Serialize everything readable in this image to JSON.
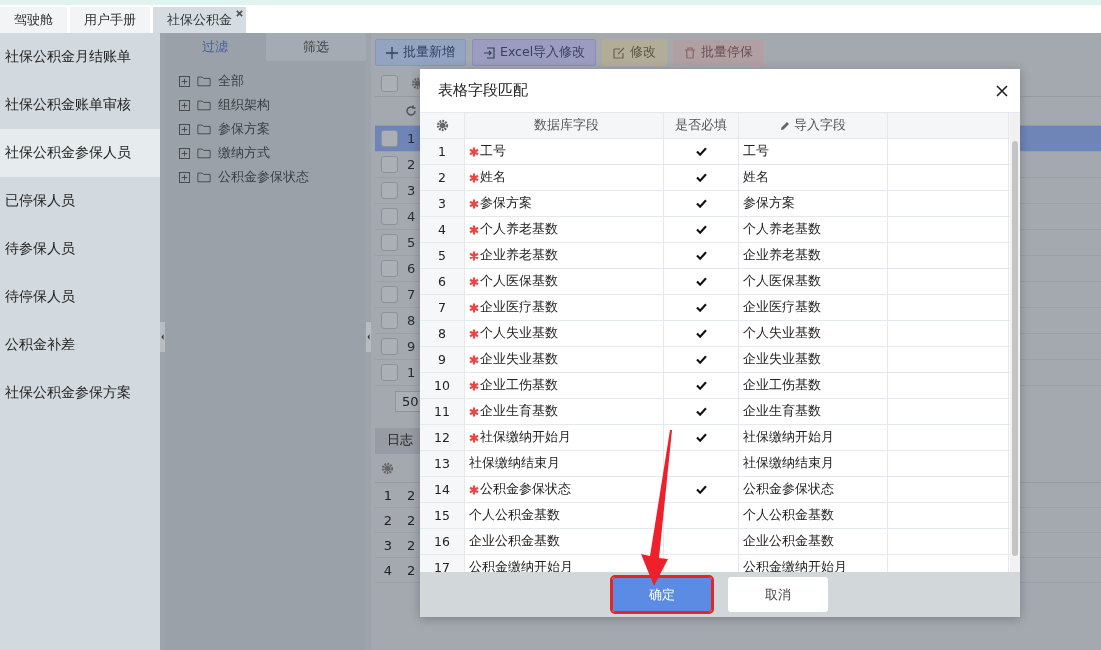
{
  "tabs": [
    {
      "label": "驾驶舱",
      "selected": false,
      "closable": false
    },
    {
      "label": "用户手册",
      "selected": false,
      "closable": false
    },
    {
      "label": "社保公积金",
      "selected": true,
      "closable": true
    }
  ],
  "sidebar": {
    "items": [
      {
        "label": "社保公积金月结账单",
        "selected": false
      },
      {
        "label": "社保公积金账单审核",
        "selected": false
      },
      {
        "label": "社保公积金参保人员",
        "selected": true
      },
      {
        "label": "已停保人员",
        "selected": false
      },
      {
        "label": "待参保人员",
        "selected": false
      },
      {
        "label": "待停保人员",
        "selected": false
      },
      {
        "label": "公积金补差",
        "selected": false
      },
      {
        "label": "社保公积金参保方案",
        "selected": false
      }
    ]
  },
  "filter_panel": {
    "tabs": [
      {
        "label": "过滤",
        "selected": true
      },
      {
        "label": "筛选",
        "selected": false
      }
    ],
    "tree": [
      {
        "label": "全部"
      },
      {
        "label": "组织架构"
      },
      {
        "label": "参保方案"
      },
      {
        "label": "缴纳方式"
      },
      {
        "label": "公积金参保状态"
      }
    ]
  },
  "toolbar": [
    {
      "kind": "add",
      "label": "批量新增"
    },
    {
      "kind": "import",
      "label": "Excel导入修改"
    },
    {
      "kind": "edit",
      "label": "修改"
    },
    {
      "kind": "delete",
      "label": "批量停保"
    }
  ],
  "table": {
    "all_checked": false,
    "rows": [
      {
        "num": "1",
        "selected": true,
        "checked": false
      },
      {
        "num": "2",
        "selected": false,
        "checked": false
      },
      {
        "num": "3",
        "selected": false,
        "checked": false
      },
      {
        "num": "4",
        "selected": false,
        "checked": false
      },
      {
        "num": "5",
        "selected": false,
        "checked": false
      },
      {
        "num": "6",
        "selected": false,
        "checked": false
      },
      {
        "num": "7",
        "selected": false,
        "checked": false
      },
      {
        "num": "8",
        "selected": false,
        "checked": false
      },
      {
        "num": "9",
        "selected": false,
        "checked": false
      },
      {
        "num": "1",
        "selected": false,
        "checked": false
      }
    ],
    "page_size": "50"
  },
  "log_panel": {
    "tab": "日志",
    "rows": [
      {
        "num": "1",
        "column_2": "2"
      },
      {
        "num": "2",
        "column_2": "2"
      },
      {
        "num": "3",
        "column_2": "2"
      },
      {
        "num": "4",
        "column_2": "2"
      }
    ]
  },
  "dialog": {
    "title": "表格字段匹配",
    "columns": [
      "数据库字段",
      "是否必填",
      "导入字段"
    ],
    "rows": [
      {
        "num": "1",
        "field": "工号",
        "required": true,
        "import": "工号"
      },
      {
        "num": "2",
        "field": "姓名",
        "required": true,
        "import": "姓名"
      },
      {
        "num": "3",
        "field": "参保方案",
        "required": true,
        "import": "参保方案"
      },
      {
        "num": "4",
        "field": "个人养老基数",
        "required": true,
        "import": "个人养老基数"
      },
      {
        "num": "5",
        "field": "企业养老基数",
        "required": true,
        "import": "企业养老基数"
      },
      {
        "num": "6",
        "field": "个人医保基数",
        "required": true,
        "import": "个人医保基数"
      },
      {
        "num": "7",
        "field": "企业医疗基数",
        "required": true,
        "import": "企业医疗基数"
      },
      {
        "num": "8",
        "field": "个人失业基数",
        "required": true,
        "import": "个人失业基数"
      },
      {
        "num": "9",
        "field": "企业失业基数",
        "required": true,
        "import": "企业失业基数"
      },
      {
        "num": "10",
        "field": "企业工伤基数",
        "required": true,
        "import": "企业工伤基数"
      },
      {
        "num": "11",
        "field": "企业生育基数",
        "required": true,
        "import": "企业生育基数"
      },
      {
        "num": "12",
        "field": "社保缴纳开始月",
        "required": true,
        "import": "社保缴纳开始月"
      },
      {
        "num": "13",
        "field": "社保缴纳结束月",
        "required": false,
        "import": "社保缴纳结束月"
      },
      {
        "num": "14",
        "field": "公积金参保状态",
        "required": true,
        "import": "公积金参保状态"
      },
      {
        "num": "15",
        "field": "个人公积金基数",
        "required": false,
        "import": "个人公积金基数"
      },
      {
        "num": "16",
        "field": "企业公积金基数",
        "required": false,
        "import": "企业公积金基数"
      },
      {
        "num": "17",
        "field": "公积金缴纳开始月",
        "required": false,
        "import": "公积金缴纳开始月"
      }
    ],
    "buttons": [
      {
        "kind": "primary",
        "label": "确定",
        "highlighted": true
      },
      {
        "kind": "secondary",
        "label": "取消",
        "highlighted": false
      }
    ]
  }
}
